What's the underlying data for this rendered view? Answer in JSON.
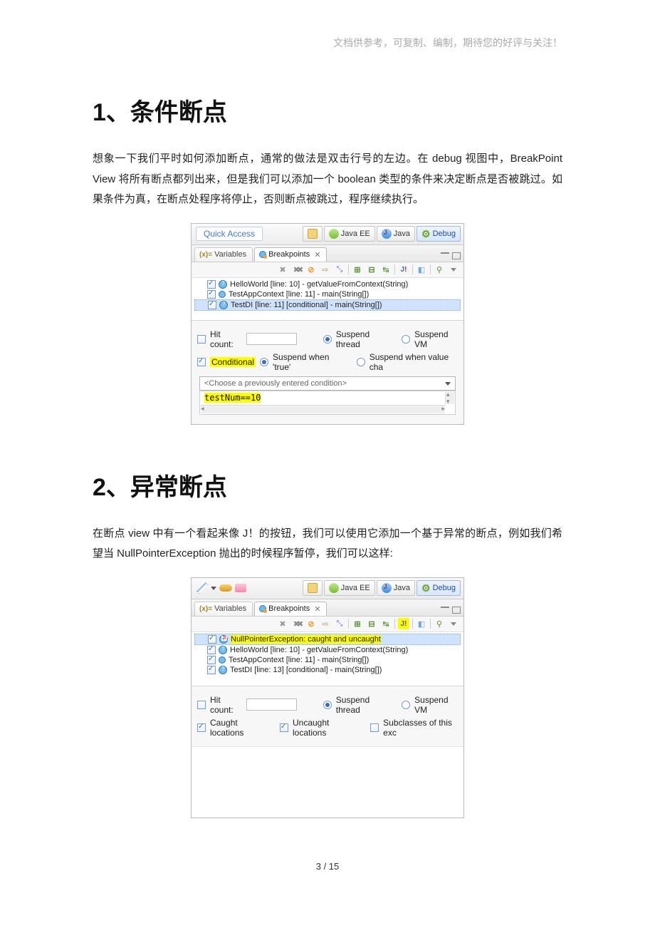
{
  "header_note": "文档供参考，可复制、编制，期待您的好评与关注！",
  "section1": {
    "title": "1、条件断点",
    "body": "想象一下我们平时如何添加断点，通常的做法是双击行号的左边。在 debug 视图中，BreakPoint View 将所有断点都列出来，但是我们可以添加一个 boolean 类型的条件来决定断点是否被跳过。如果条件为真，在断点处程序将停止，否则断点被跳过，程序继续执行。"
  },
  "section2": {
    "title": "2、异常断点",
    "body": "在断点 view 中有一个看起来像 J！的按钮，我们可以使用它添加一个基于异常的断点，例如我们希望当 NullPointerException 抛出的时候程序暂停，我们可以这样:"
  },
  "panel1": {
    "quick_access": "Quick Access",
    "perspectives": {
      "java_ee": "Java EE",
      "java": "Java",
      "debug": "Debug"
    },
    "tabs": {
      "variables": "Variables",
      "breakpoints": "Breakpoints"
    },
    "breakpoints": [
      {
        "checked": true,
        "icon": "cond",
        "label": "HelloWorld [line: 10] - getValueFromContext(String)"
      },
      {
        "checked": true,
        "icon": "plain",
        "label": "TestAppContext [line: 11] - main(String[])"
      },
      {
        "checked": true,
        "icon": "cond",
        "label": "TestDI [line: 11] [conditional] - main(String[])",
        "selected": true
      }
    ],
    "form": {
      "hit_count": "Hit count:",
      "suspend_thread": "Suspend thread",
      "suspend_vm": "Suspend VM",
      "conditional": "Conditional",
      "suspend_when_true": "Suspend when 'true'",
      "suspend_when_change": "Suspend when value cha",
      "combo_placeholder": "<Choose a previously entered condition>",
      "condition_text": "testNum==10"
    }
  },
  "panel2": {
    "perspectives": {
      "java_ee": "Java EE",
      "java": "Java",
      "debug": "Debug"
    },
    "tabs": {
      "variables": "Variables",
      "breakpoints": "Breakpoints"
    },
    "breakpoints": [
      {
        "checked": true,
        "icon": "exc",
        "label": "NullPointerException: caught and uncaught",
        "selected": true,
        "highlight": true
      },
      {
        "checked": true,
        "icon": "cond",
        "label": "HelloWorld [line: 10] - getValueFromContext(String)"
      },
      {
        "checked": true,
        "icon": "plain",
        "label": "TestAppContext [line: 11] - main(String[])"
      },
      {
        "checked": true,
        "icon": "cond",
        "label": "TestDI [line: 13] [conditional] - main(String[])"
      }
    ],
    "form": {
      "hit_count": "Hit count:",
      "suspend_thread": "Suspend thread",
      "suspend_vm": "Suspend VM",
      "caught": "Caught locations",
      "uncaught": "Uncaught locations",
      "subclasses": "Subclasses of this exc"
    }
  },
  "footer": {
    "page": "3 / 15"
  }
}
